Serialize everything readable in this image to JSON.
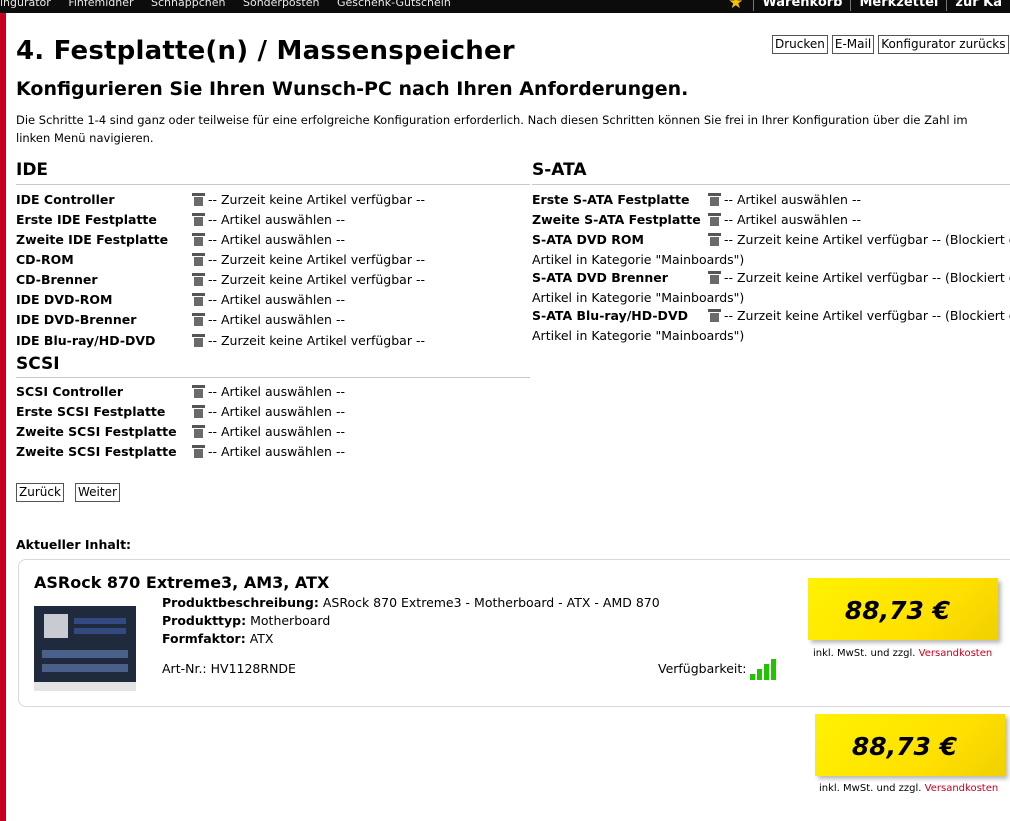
{
  "topbar": {
    "nav": [
      "ingurator",
      "Finfemidner",
      "Schnappchen",
      "Sonderposten",
      "Geschenk-Gutschein"
    ],
    "star_icon": "star-icon",
    "right": [
      "Warenkorb",
      "Merkzettel",
      "zur Ka"
    ]
  },
  "page": {
    "title": "4. Festplatte(n) / Massenspeicher",
    "buttons": {
      "print": "Drucken",
      "email": "E-Mail",
      "back_config": "Konfigurator zurücks"
    },
    "subtitle": "Konfigurieren Sie Ihren Wunsch-PC nach Ihren Anforderungen.",
    "intro_line1": "Die Schritte 1-4 sind ganz oder teilweise für eine erfolgreiche Konfiguration erforderlich. Nach diesen Schritten können Sie frei in Ihrer Konfiguration über die Zahl im",
    "intro_line2": "linken Menü navigieren."
  },
  "ide": {
    "heading": "IDE",
    "items": [
      {
        "label": "IDE Controller",
        "value": "-- Zurzeit keine Artikel verfügbar --"
      },
      {
        "label": "Erste IDE Festplatte",
        "value": "-- Artikel auswählen --"
      },
      {
        "label": "Zweite IDE Festplatte",
        "value": "-- Artikel auswählen --"
      },
      {
        "label": "CD-ROM",
        "value": "-- Zurzeit keine Artikel verfügbar --"
      },
      {
        "label": "CD-Brenner",
        "value": "-- Zurzeit keine Artikel verfügbar --"
      },
      {
        "label": "IDE DVD-ROM",
        "value": "-- Artikel auswählen --"
      },
      {
        "label": "IDE DVD-Brenner",
        "value": "-- Artikel auswählen --"
      },
      {
        "label": "IDE Blu-ray/HD-DVD",
        "value": "-- Zurzeit keine Artikel verfügbar --"
      }
    ]
  },
  "scsi": {
    "heading": "SCSI",
    "items": [
      {
        "label": "SCSI Controller",
        "value": "-- Artikel auswählen --"
      },
      {
        "label": "Erste SCSI Festplatte",
        "value": "-- Artikel auswählen --"
      },
      {
        "label": "Zweite SCSI Festplatte",
        "value": "-- Artikel auswählen --"
      },
      {
        "label": "Zweite SCSI Festplatte",
        "value": "-- Artikel auswählen --"
      }
    ]
  },
  "sata": {
    "heading": "S-ATA",
    "items": [
      {
        "label": "Erste S-ATA Festplatte",
        "value": "-- Artikel auswählen --"
      },
      {
        "label": "Zweite S-ATA Festplatte",
        "value": "-- Artikel auswählen --"
      },
      {
        "label": "S-ATA DVD ROM",
        "value": "-- Zurzeit keine Artikel verfügbar -- (Blockiert d",
        "wrap": "Artikel in Kategorie \"Mainboards\")"
      },
      {
        "label": "S-ATA DVD Brenner",
        "value": "-- Zurzeit keine Artikel verfügbar -- (Blockiert d",
        "wrap": "Artikel in Kategorie \"Mainboards\")"
      },
      {
        "label": "S-ATA Blu-ray/HD-DVD",
        "value": "-- Zurzeit keine Artikel verfügbar -- (Blockiert d",
        "wrap": "Artikel in Kategorie \"Mainboards\")"
      }
    ]
  },
  "nav_buttons": {
    "back": "Zurück",
    "next": "Weiter"
  },
  "current": {
    "heading": "Aktueller Inhalt:",
    "product": {
      "name": "ASRock 870 Extreme3, AM3, ATX",
      "desc_label": "Produktbeschreibung:",
      "desc_value": "ASRock 870 Extreme3 - Motherboard - ATX - AMD 870",
      "type_label": "Produkttyp:",
      "type_value": "Motherboard",
      "form_label": "Formfaktor:",
      "form_value": "ATX",
      "artnr_label": "Art-Nr.:",
      "artnr_value": "HV1128RNDE",
      "avail_label": "Verfügbarkeit:",
      "avail_level": 4,
      "avail_max": 4,
      "price": "88,73 €",
      "vat": "inkl. MwSt. und zzgl.",
      "shipping": "Versandkosten"
    },
    "total": {
      "price": "88,73 €",
      "vat": "inkl. MwSt. und zzgl.",
      "shipping": "Versandkosten"
    }
  },
  "colors": {
    "accent_red": "#c4001e",
    "price_yellow": "#ffe800",
    "avail_green": "#22c400"
  }
}
